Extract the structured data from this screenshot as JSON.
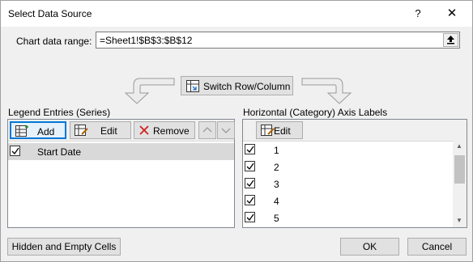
{
  "dialog": {
    "title": "Select Data Source",
    "help": "?",
    "close": "✕"
  },
  "range": {
    "label": "Chart data range:",
    "value": "=Sheet1!$B$3:$B$12"
  },
  "switch": {
    "label": "Switch Row/Column"
  },
  "legend": {
    "heading": "Legend Entries (Series)",
    "add": "Add",
    "edit": "Edit",
    "remove": "Remove",
    "items": [
      {
        "label": "Start Date",
        "checked": true,
        "selected": true
      }
    ]
  },
  "axis": {
    "heading": "Horizontal (Category) Axis Labels",
    "edit": "Edit",
    "items": [
      {
        "label": "1",
        "checked": true
      },
      {
        "label": "2",
        "checked": true
      },
      {
        "label": "3",
        "checked": true
      },
      {
        "label": "4",
        "checked": true
      },
      {
        "label": "5",
        "checked": true
      }
    ]
  },
  "footer": {
    "hidden_cells": "Hidden and Empty Cells",
    "ok": "OK",
    "cancel": "Cancel"
  },
  "colors": {
    "accent": "#0078d7",
    "selection": "#d9d9d9"
  }
}
